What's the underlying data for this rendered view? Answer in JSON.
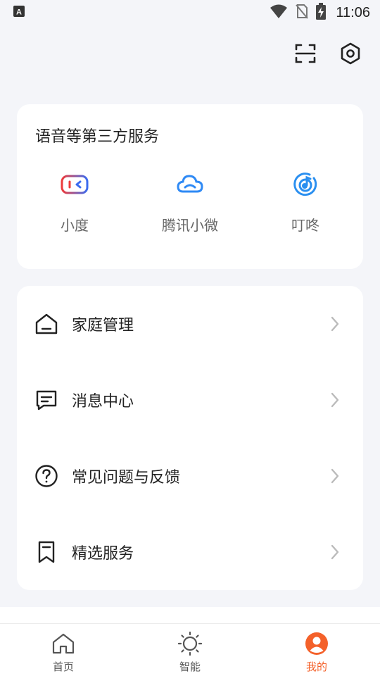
{
  "status_bar": {
    "time": "11:06",
    "icons": [
      "a-badge-icon",
      "wifi-icon",
      "no-sim-icon",
      "battery-charging-icon"
    ]
  },
  "top_actions": {
    "icons": [
      "scan-icon",
      "settings-icon"
    ]
  },
  "voice_services": {
    "title": "语音等第三方服务",
    "items": [
      {
        "label": "小度",
        "icon": "xiaodu-icon"
      },
      {
        "label": "腾讯小微",
        "icon": "tencent-xiaowei-icon"
      },
      {
        "label": "叮咚",
        "icon": "dingdong-icon"
      }
    ]
  },
  "menu": {
    "items": [
      {
        "label": "家庭管理",
        "icon": "home-outline-icon"
      },
      {
        "label": "消息中心",
        "icon": "message-icon"
      },
      {
        "label": "常见问题与反馈",
        "icon": "help-circle-icon"
      },
      {
        "label": "精选服务",
        "icon": "bookmark-icon"
      }
    ]
  },
  "bottom_nav": {
    "items": [
      {
        "label": "首页",
        "icon": "home-icon",
        "active": false
      },
      {
        "label": "智能",
        "icon": "sun-icon",
        "active": false
      },
      {
        "label": "我的",
        "icon": "user-icon",
        "active": true
      }
    ]
  },
  "colors": {
    "accent": "#f4612a",
    "background": "#f4f5f9",
    "xiaodu_red": "#ee3b3b",
    "xiaodu_blue": "#3b6cf0",
    "tencent_blue": "#2f8af5",
    "dingdong_blue": "#2a8ff0"
  }
}
